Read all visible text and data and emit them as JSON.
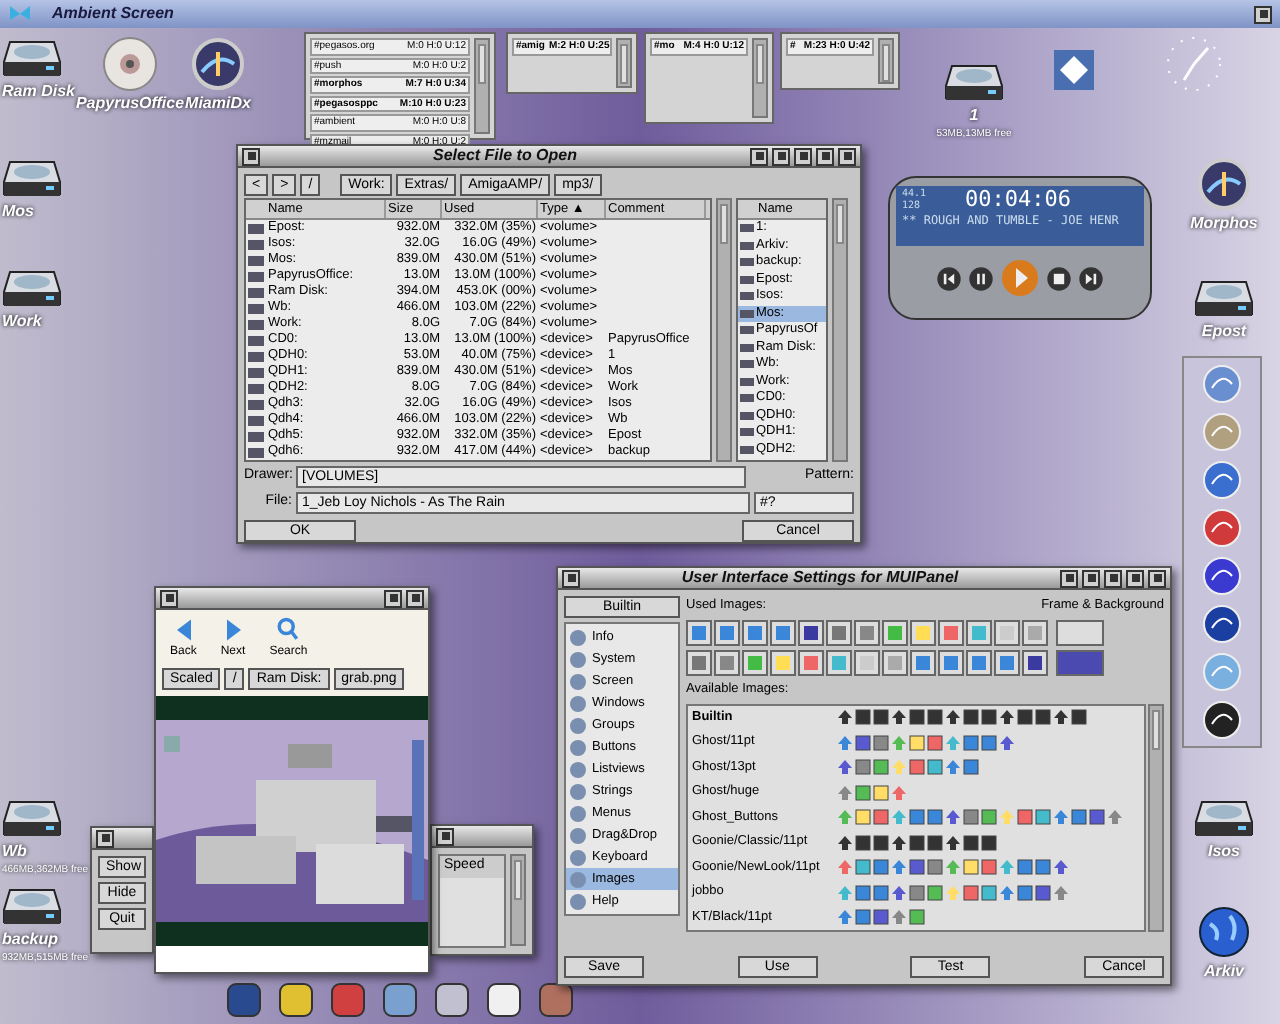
{
  "screen": {
    "title": "Ambient Screen"
  },
  "desktop_icons": [
    {
      "label": "Ram Disk",
      "kind": "drive"
    },
    {
      "label": "PapyrusOffice",
      "kind": "disc"
    },
    {
      "label": "MiamiDx",
      "kind": "app"
    },
    {
      "label": "1",
      "info": "53MB,13MB free",
      "kind": "drive"
    },
    {
      "label": "Mos",
      "kind": "drive"
    },
    {
      "label": "Work",
      "kind": "drive"
    },
    {
      "label": "Morphos",
      "kind": "app"
    },
    {
      "label": "Epost",
      "kind": "drive"
    },
    {
      "label": "Wb",
      "info": "466MB,362MB free",
      "kind": "drive"
    },
    {
      "label": "backup",
      "info": "932MB,515MB free",
      "kind": "drive"
    },
    {
      "label": "Isos",
      "kind": "drive"
    },
    {
      "label": "Arkiv",
      "kind": "globe"
    }
  ],
  "irc_windows": [
    {
      "channels": [
        {
          "name": "#pegasos.org",
          "stats": "M:0 H:0 U:12",
          "highlighted": false
        },
        {
          "name": "#push",
          "stats": "M:0 H:0 U:2",
          "highlighted": false
        },
        {
          "name": "#morphos",
          "stats": "M:7 H:0 U:34",
          "highlighted": true
        },
        {
          "name": "#pegasosppc",
          "stats": "M:10 H:0 U:23",
          "highlighted": true
        },
        {
          "name": "#ambient",
          "stats": "M:0 H:0 U:8",
          "highlighted": false
        },
        {
          "name": "#mzmail",
          "stats": "M:0 H:0 U:2",
          "highlighted": false
        }
      ]
    },
    {
      "channels": [
        {
          "name": "#amig",
          "stats": "M:2 H:0 U:25",
          "highlighted": true
        }
      ]
    },
    {
      "channels": [
        {
          "name": "#mo",
          "stats": "M:4 H:0 U:12",
          "highlighted": true
        }
      ]
    },
    {
      "channels": [
        {
          "name": "#",
          "stats": "M:23 H:0 U:42",
          "highlighted": true
        }
      ]
    }
  ],
  "file_requester": {
    "title": "Select File to Open",
    "nav_buttons": [
      "<",
      ">",
      "/"
    ],
    "path_buttons": [
      "Work:",
      "Extras/",
      "AmigaAMP/",
      "mp3/"
    ],
    "columns": [
      "Name",
      "Size",
      "Used",
      "Type ▲",
      "Comment"
    ],
    "rows": [
      [
        "Epost:",
        "932.0M",
        "332.0M (35%)",
        "<volume>",
        ""
      ],
      [
        "Isos:",
        "32.0G",
        "16.0G (49%)",
        "<volume>",
        ""
      ],
      [
        "Mos:",
        "839.0M",
        "430.0M (51%)",
        "<volume>",
        ""
      ],
      [
        "PapyrusOffice:",
        "13.0M",
        "13.0M (100%)",
        "<volume>",
        ""
      ],
      [
        "Ram Disk:",
        "394.0M",
        "453.0K (00%)",
        "<volume>",
        ""
      ],
      [
        "Wb:",
        "466.0M",
        "103.0M (22%)",
        "<volume>",
        ""
      ],
      [
        "Work:",
        "8.0G",
        "7.0G (84%)",
        "<volume>",
        ""
      ],
      [
        "CD0:",
        "13.0M",
        "13.0M (100%)",
        "<device>",
        "PapyrusOffice"
      ],
      [
        "QDH0:",
        "53.0M",
        "40.0M (75%)",
        "<device>",
        "1"
      ],
      [
        "QDH1:",
        "839.0M",
        "430.0M (51%)",
        "<device>",
        "Mos"
      ],
      [
        "QDH2:",
        "8.0G",
        "7.0G (84%)",
        "<device>",
        "Work"
      ],
      [
        "Qdh3:",
        "32.0G",
        "16.0G (49%)",
        "<device>",
        "Isos"
      ],
      [
        "Qdh4:",
        "466.0M",
        "103.0M (22%)",
        "<device>",
        "Wb"
      ],
      [
        "Qdh5:",
        "932.0M",
        "332.0M (35%)",
        "<device>",
        "Epost"
      ],
      [
        "Qdh6:",
        "932.0M",
        "417.0M (44%)",
        "<device>",
        "backup"
      ]
    ],
    "volumes_header": "Name",
    "volumes": [
      {
        "name": "1:",
        "selected": false
      },
      {
        "name": "Arkiv:",
        "selected": false
      },
      {
        "name": "backup:",
        "selected": false
      },
      {
        "name": "Epost:",
        "selected": false
      },
      {
        "name": "Isos:",
        "selected": false
      },
      {
        "name": "Mos:",
        "selected": true
      },
      {
        "name": "PapyrusOf",
        "selected": false
      },
      {
        "name": "Ram Disk:",
        "selected": false
      },
      {
        "name": "Wb:",
        "selected": false
      },
      {
        "name": "Work:",
        "selected": false
      },
      {
        "name": "CD0:",
        "selected": false
      },
      {
        "name": "QDH0:",
        "selected": false
      },
      {
        "name": "QDH1:",
        "selected": false
      },
      {
        "name": "QDH2:",
        "selected": false
      }
    ],
    "drawer_label": "Drawer:",
    "drawer": "[VOLUMES]",
    "file_label": "File:",
    "file": "1_Jeb Loy Nichols - As The Rain",
    "pattern_label": "Pattern:",
    "pattern": "#?",
    "ok": "OK",
    "cancel": "Cancel"
  },
  "player": {
    "khz": "44.1",
    "kbps": "128",
    "time": "00:04:06",
    "track": "** ROUGH AND TUMBLE - JOE HENR"
  },
  "viewer": {
    "nav": [
      "Back",
      "Next",
      "Search"
    ],
    "path": [
      "Scaled",
      "/",
      "Ram Disk:",
      "grab.png"
    ]
  },
  "load_window": {
    "buttons": [
      "Show",
      "Hide",
      "Quit"
    ]
  },
  "speed_window": {
    "header": "Speed"
  },
  "mui": {
    "title": "User Interface Settings for MUIPanel",
    "list_header": "Builtin",
    "categories": [
      {
        "label": "Info",
        "selected": false
      },
      {
        "label": "System",
        "selected": false
      },
      {
        "label": "Screen",
        "selected": false
      },
      {
        "label": "Windows",
        "selected": false
      },
      {
        "label": "Groups",
        "selected": false
      },
      {
        "label": "Buttons",
        "selected": false
      },
      {
        "label": "Listviews",
        "selected": false
      },
      {
        "label": "Strings",
        "selected": false
      },
      {
        "label": "Menus",
        "selected": false
      },
      {
        "label": "Drag&Drop",
        "selected": false
      },
      {
        "label": "Keyboard",
        "selected": false
      },
      {
        "label": "Images",
        "selected": true
      },
      {
        "label": "Help",
        "selected": false
      }
    ],
    "used_label": "Used Images:",
    "frame_label": "Frame & Background",
    "available_label": "Available Images:",
    "image_sets": [
      {
        "name": "Builtin",
        "highlighted": true
      },
      {
        "name": "Ghost/11pt",
        "highlighted": false
      },
      {
        "name": "Ghost/13pt",
        "highlighted": false
      },
      {
        "name": "Ghost/huge",
        "highlighted": false
      },
      {
        "name": "Ghost_Buttons",
        "highlighted": false
      },
      {
        "name": "Goonie/Classic/11pt",
        "highlighted": false
      },
      {
        "name": "Goonie/NewLook/11pt",
        "highlighted": false
      },
      {
        "name": "jobbo",
        "highlighted": false
      },
      {
        "name": "KT/Black/11pt",
        "highlighted": false
      }
    ],
    "buttons": [
      "Save",
      "Use",
      "Test",
      "Cancel"
    ]
  }
}
